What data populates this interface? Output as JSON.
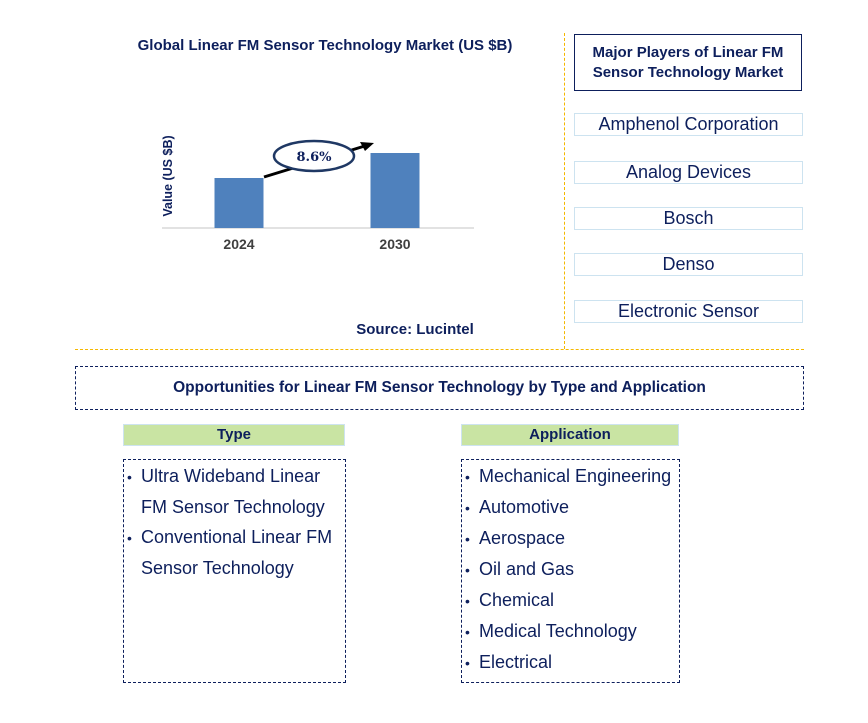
{
  "chart_data": {
    "type": "bar",
    "title": "Global Linear FM Sensor Technology Market (US $B)",
    "xlabel": "",
    "ylabel": "Value (US $B)",
    "categories": [
      "2024",
      "2030"
    ],
    "values": [
      2.0,
      3.0
    ],
    "value_note": "relative bar heights only; no values printed",
    "ylim": [
      0,
      4.0
    ],
    "grid": false,
    "annotation": {
      "text": "8.6%",
      "meaning": "CAGR 2024-2030",
      "style": "ellipse with arrow"
    },
    "bar_color": "#4f81bd"
  },
  "source": "Source: Lucintel",
  "players": {
    "title": "Major Players of Linear FM Sensor Technology Market",
    "items": [
      "Amphenol Corporation",
      "Analog Devices",
      "Bosch",
      "Denso",
      "Electronic Sensor"
    ]
  },
  "opportunities": {
    "title": "Opportunities for Linear FM Sensor Technology by Type and Application",
    "type": {
      "heading": "Type",
      "items": [
        "Ultra Wideband Linear FM Sensor Technology",
        "Conventional Linear FM Sensor Technology"
      ]
    },
    "application": {
      "heading": "Application",
      "items": [
        "Mechanical Engineering",
        "Automotive",
        "Aerospace",
        "Oil and Gas",
        "Chemical",
        "Medical Technology",
        "Electrical"
      ]
    }
  },
  "colors": {
    "text": "#0d1f5c",
    "bar": "#4f81bd",
    "header_green": "#c9e4a3",
    "divider": "#f5b800"
  }
}
